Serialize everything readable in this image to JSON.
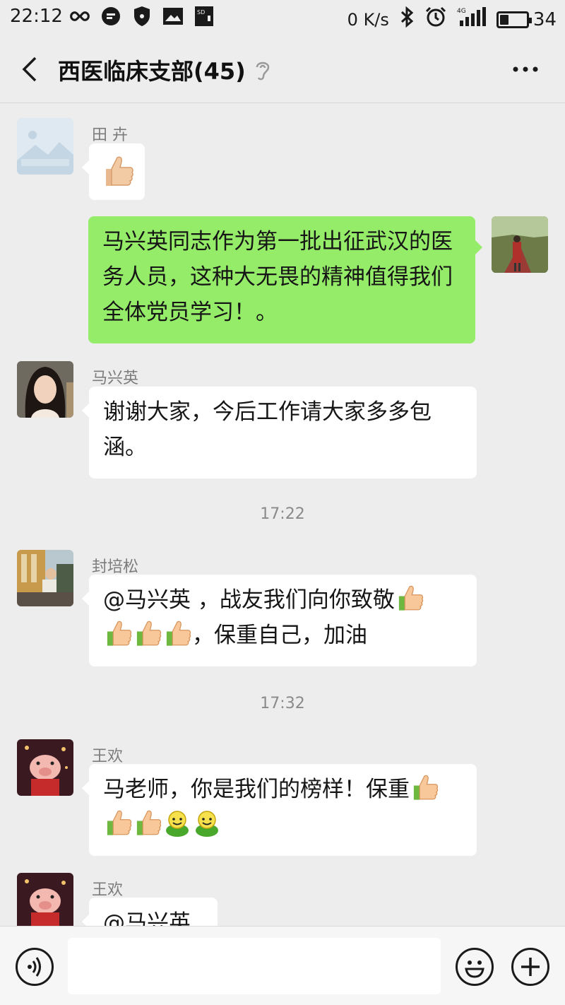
{
  "status_bar": {
    "time": "22:12",
    "net_speed": "0 K/s",
    "network": "4G",
    "battery": "34",
    "battery_level_percent": 34
  },
  "header": {
    "title": "西医临床支部(45)"
  },
  "messages": [
    {
      "sender": "田 卉",
      "side": "left",
      "content": "[thumbs-up sticker]"
    },
    {
      "sender": "",
      "side": "right",
      "content": "马兴英同志作为第一批出征武汉的医务人员，这种大无畏的精神值得我们全体党员学习！。"
    },
    {
      "sender": "马兴英",
      "side": "left",
      "content": "谢谢大家，今后工作请大家多多包涵。"
    },
    {
      "timestamp": "17:22"
    },
    {
      "sender": "封培松",
      "side": "left",
      "content_text_1": "@马兴英 ，战友我们向你致敬",
      "content_text_2": "，保重自己，加油"
    },
    {
      "timestamp": "17:32"
    },
    {
      "sender": "王欢",
      "side": "left",
      "content": "马老师，你是我们的榜样！保重"
    },
    {
      "sender": "王欢",
      "side": "left",
      "content": "@马兴英"
    }
  ],
  "icons": {
    "back": "back-arrow-icon",
    "ear": "ear-icon",
    "more": "more-icon",
    "voice": "voice-icon",
    "emoji": "emoji-icon",
    "plus": "plus-icon",
    "thumb": "thumbs-up-icon",
    "green_face": "green-face-icon"
  },
  "colors": {
    "chat_bg": "#ededed",
    "my_bubble": "#95ec69",
    "other_bubble": "#ffffff"
  },
  "input": {
    "value": "",
    "placeholder": ""
  }
}
